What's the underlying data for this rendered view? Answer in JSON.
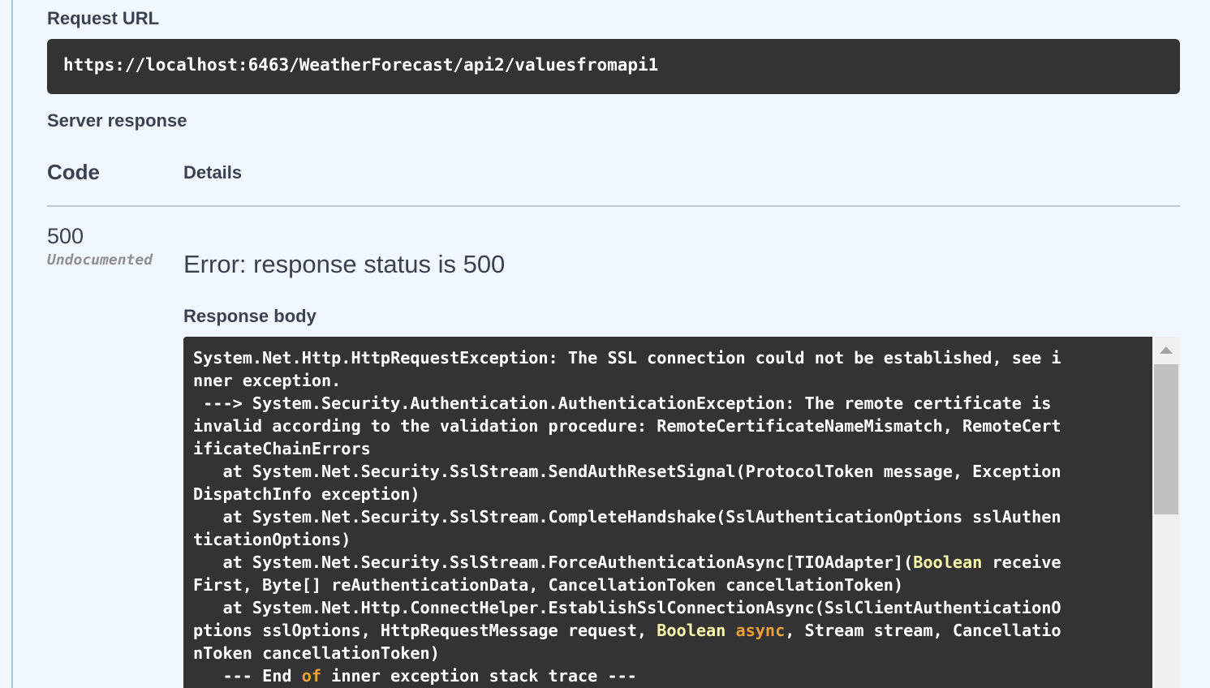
{
  "request_url": {
    "label": "Request URL",
    "value": "https://localhost:6463/WeatherForecast/api2/valuesfromapi1"
  },
  "server_response": {
    "label": "Server response",
    "columns": {
      "code": "Code",
      "details": "Details"
    },
    "row": {
      "status_code": "500",
      "status_note": "Undocumented",
      "error_title": "Error: response status is 500",
      "response_body_label": "Response body",
      "body_lines": [
        "System.Net.Http.HttpRequestException: The SSL connection could not be established, see i",
        "nner exception.",
        " ---> System.Security.Authentication.AuthenticationException: The remote certificate is",
        "invalid according to the validation procedure: RemoteCertificateNameMismatch, RemoteCert",
        "ificateChainErrors",
        "   at System.Net.Security.SslStream.SendAuthResetSignal(ProtocolToken message, Exception",
        "DispatchInfo exception)",
        "   at System.Net.Security.SslStream.CompleteHandshake(SslAuthenticationOptions sslAuthen",
        "ticationOptions)",
        "   at System.Net.Security.SslStream.ForceAuthenticationAsync[TIOAdapter](Boolean receive",
        "First, Byte[] reAuthenticationData, CancellationToken cancellationToken)",
        "   at System.Net.Http.ConnectHelper.EstablishSslConnectionAsync(SslClientAuthenticationO",
        "ptions sslOptions, HttpRequestMessage request, Boolean async, Stream stream, Cancellatio",
        "nToken cancellationToken)",
        "   --- End of inner exception stack trace ---"
      ],
      "highlight_keywords": {
        "type_names": [
          "Boolean"
        ],
        "keywords": [
          "async",
          "of"
        ]
      }
    }
  },
  "colors": {
    "page_background": "#f0f7fe",
    "code_background": "#333333",
    "code_text": "#ffffff",
    "type_highlight": "#f8f8a8",
    "keyword_highlight": "#f0a030",
    "label_text": "#3b4151",
    "muted_text": "#909090"
  }
}
